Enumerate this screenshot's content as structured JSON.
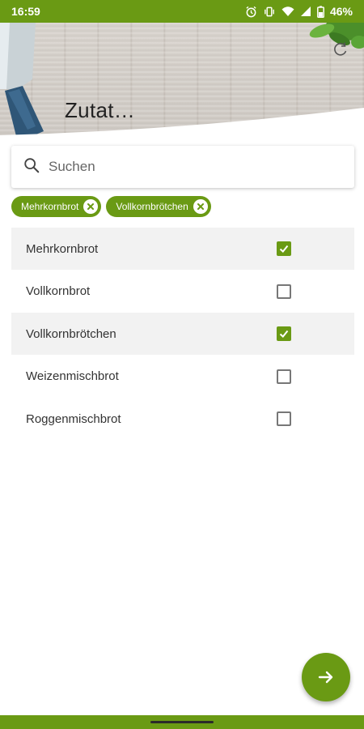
{
  "status_bar": {
    "time": "16:59",
    "battery": "46%",
    "icons": [
      "alarm-icon",
      "vibrate-icon",
      "wifi-icon",
      "signal-icon",
      "battery-icon"
    ]
  },
  "header": {
    "title": "Zutat…",
    "refresh_icon": "refresh-icon"
  },
  "search": {
    "placeholder": "Suchen",
    "value": ""
  },
  "chips": [
    {
      "label": "Mehrkornbrot"
    },
    {
      "label": "Vollkornbrötchen"
    }
  ],
  "items": [
    {
      "label": "Mehrkornbrot",
      "checked": true
    },
    {
      "label": "Vollkornbrot",
      "checked": false
    },
    {
      "label": "Vollkornbrötchen",
      "checked": true
    },
    {
      "label": "Weizenmischbrot",
      "checked": false
    },
    {
      "label": "Roggenmischbrot",
      "checked": false
    }
  ],
  "fab": {
    "icon": "arrow-right-icon"
  },
  "colors": {
    "accent": "#6a9a14",
    "selected_row": "#f2f2f2"
  }
}
